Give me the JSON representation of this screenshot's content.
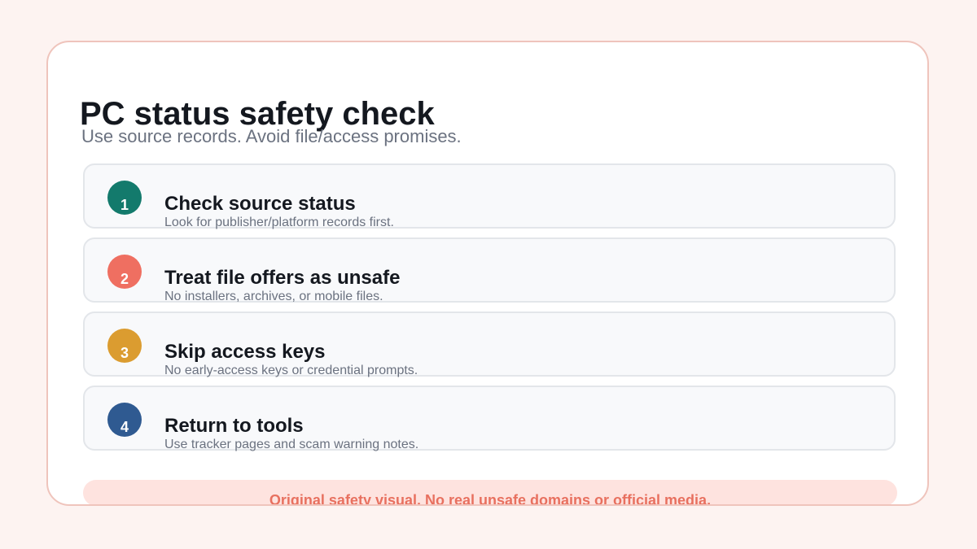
{
  "title": "PC status safety check",
  "subtitle": "Use source records. Avoid file/access promises.",
  "steps": [
    {
      "number": "1",
      "title": "Check source status",
      "description": "Look for publisher/platform records first.",
      "color": "#137a6c"
    },
    {
      "number": "2",
      "title": "Treat file offers as unsafe",
      "description": "No installers, archives, or mobile files.",
      "color": "#ef6f61"
    },
    {
      "number": "3",
      "title": "Skip access keys",
      "description": "No early-access keys or credential prompts.",
      "color": "#db9c30"
    },
    {
      "number": "4",
      "title": "Return to tools",
      "description": "Use tracker pages and scam warning notes.",
      "color": "#2f5a91"
    }
  ],
  "footer": "Original safety visual. No real unsafe domains or official media."
}
